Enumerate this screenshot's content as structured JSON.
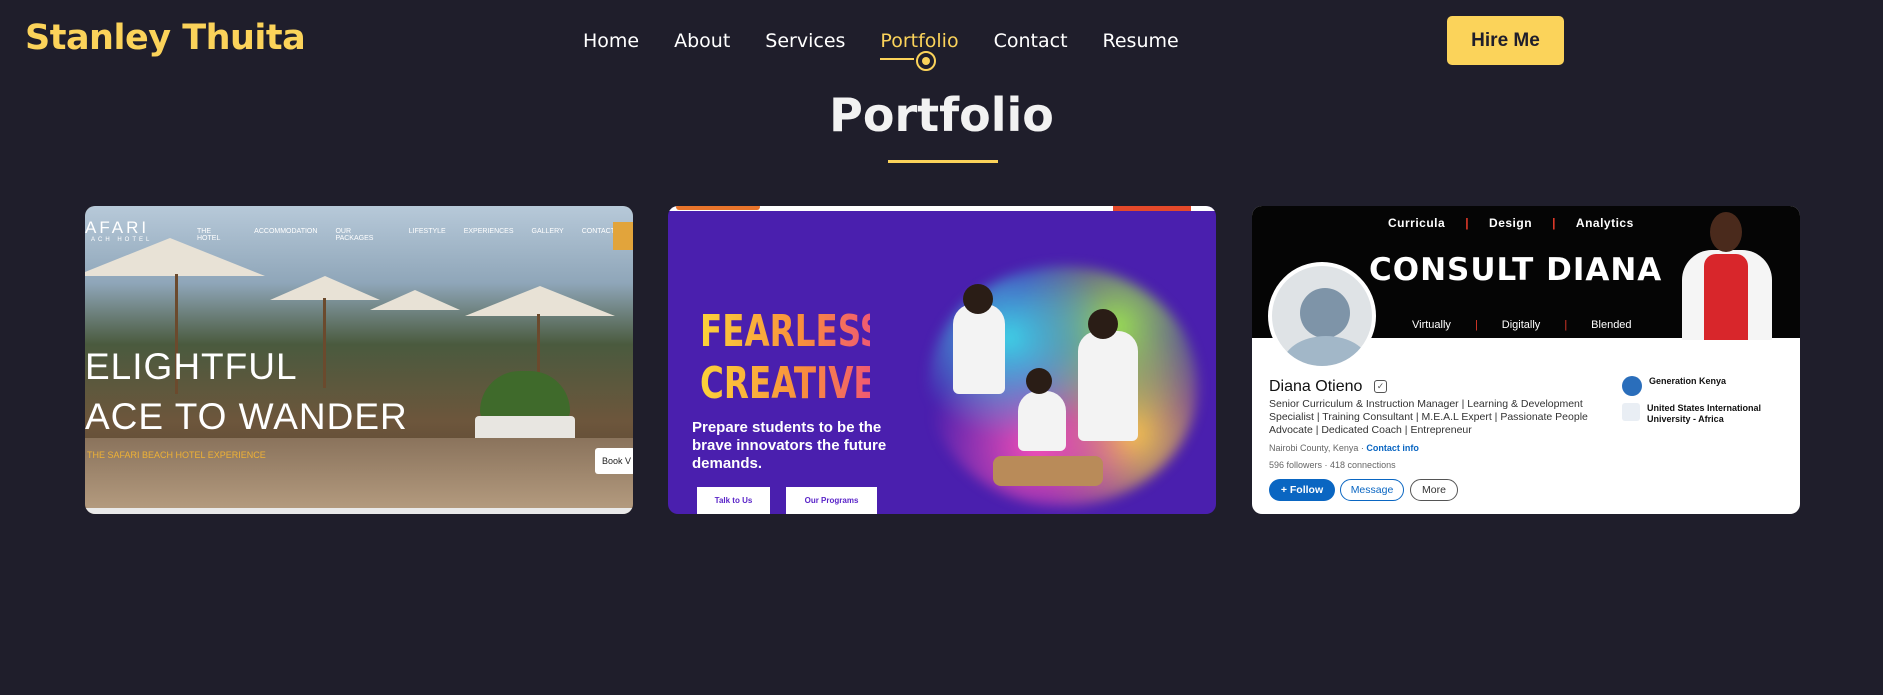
{
  "header": {
    "logo": "Stanley Thuita",
    "nav": [
      {
        "label": "Home"
      },
      {
        "label": "About"
      },
      {
        "label": "Services"
      },
      {
        "label": "Portfolio",
        "active": true
      },
      {
        "label": "Contact"
      },
      {
        "label": "Resume"
      }
    ],
    "cta": "Hire Me"
  },
  "section": {
    "title": "Portfolio"
  },
  "colors": {
    "background": "#1f1e2b",
    "accent": "#fbd35a"
  },
  "projects": [
    {
      "brand": "AFARI",
      "brand_sub": "ACH HOTEL",
      "menu": [
        "THE HOTEL",
        "ACCOMMODATION",
        "OUR PACKAGES",
        "LIFESTYLE",
        "EXPERIENCES",
        "GALLERY",
        "CONTACT"
      ],
      "headline_1": "ELIGHTFUL",
      "headline_2": "ACE TO WANDER",
      "tagline": "THE SAFARI BEACH HOTEL EXPERIENCE",
      "button": "Book V"
    },
    {
      "headline": "FEARLESSLY CREATIVE",
      "subheadline": "Prepare students to be the brave innovators the future demands.",
      "button_1": "Talk to Us",
      "button_2": "Our Programs"
    },
    {
      "banner_top": [
        "Curricula",
        "|",
        "Design",
        "|",
        "Analytics"
      ],
      "banner_title": "CONSULT DIANA",
      "banner_bottom": [
        "Virtually",
        "|",
        "Digitally",
        "|",
        "Blended"
      ],
      "name": "Diana Otieno",
      "headline": "Senior Curriculum & Instruction Manager | Learning & Development Specialist | Training Consultant | M.E.A.L Expert | Passionate People Advocate | Dedicated Coach | Entrepreneur",
      "location": "Nairobi County, Kenya · ",
      "contact_link": "Contact info",
      "stats": "596 followers · 418 connections",
      "follow": "+ Follow",
      "message": "Message",
      "more": "More",
      "org_1": "Generation Kenya",
      "org_2": "United States International University - Africa"
    }
  ]
}
